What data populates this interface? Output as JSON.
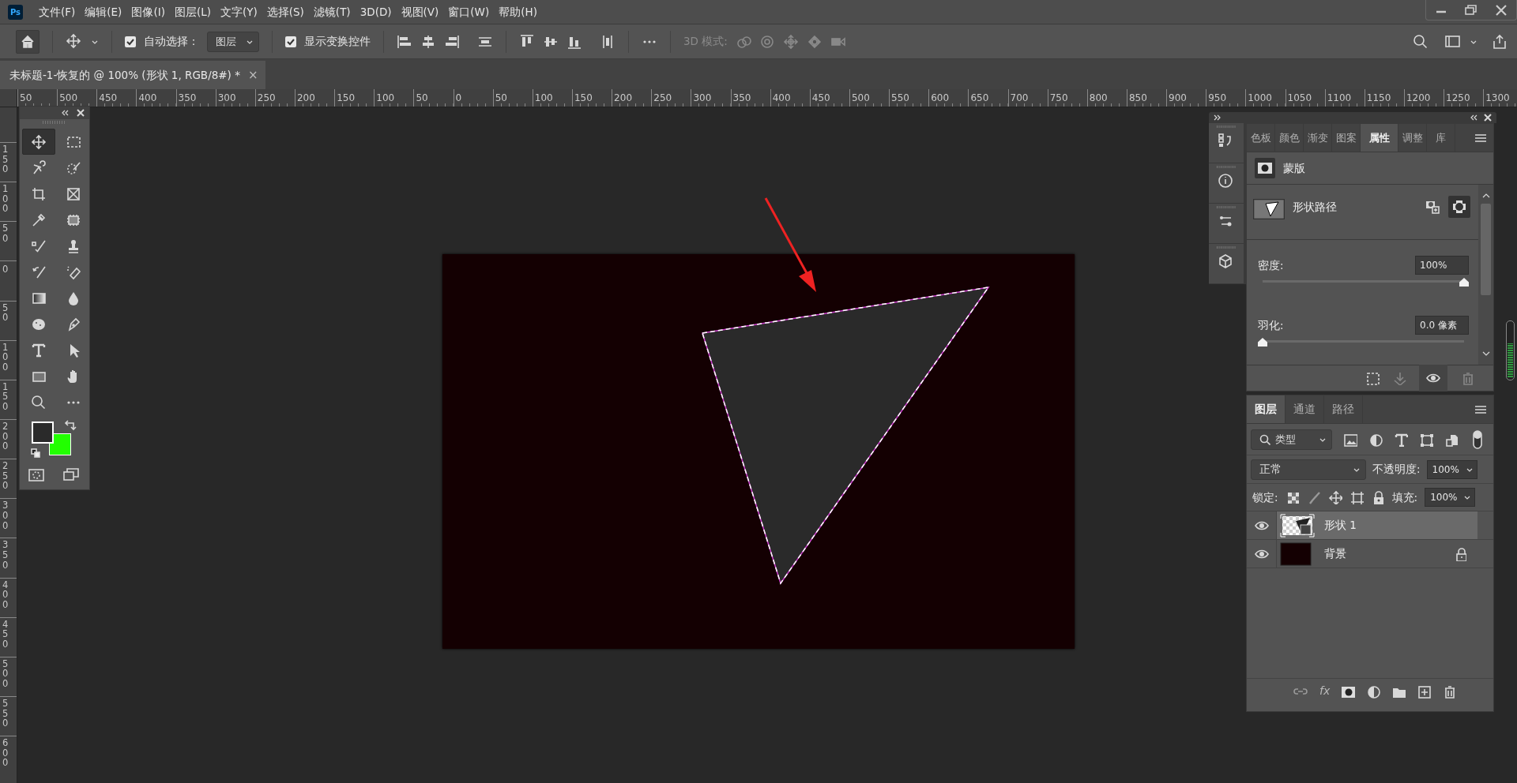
{
  "menu_bar": {
    "app_icon": "Ps",
    "items": [
      "文件(F)",
      "编辑(E)",
      "图像(I)",
      "图层(L)",
      "文字(Y)",
      "选择(S)",
      "滤镜(T)",
      "3D(D)",
      "视图(V)",
      "窗口(W)",
      "帮助(H)"
    ]
  },
  "options_bar": {
    "auto_select": {
      "label": "自动选择：",
      "checked": true
    },
    "auto_select_target": "图层",
    "show_transform": {
      "label": "显示变换控件",
      "checked": true
    },
    "mode_3d_label": "3D 模式:"
  },
  "document_tabs": [
    {
      "title": "未标题-1-恢复的 @ 100% (形状 1, RGB/8#) *",
      "selected": true,
      "close": "×"
    }
  ],
  "rulers": {
    "horizontal": [
      "50",
      "500",
      "450",
      "400",
      "350",
      "300",
      "250",
      "200",
      "150",
      "100",
      "50",
      "0",
      "50",
      "100",
      "150",
      "200",
      "250",
      "300",
      "350",
      "400",
      "450",
      "500",
      "550",
      "600",
      "650",
      "700",
      "750",
      "800",
      "850",
      "900",
      "950",
      "1000",
      "1050",
      "1100",
      "1150",
      "1200",
      "1250",
      "1300"
    ],
    "vertical": [
      "150",
      "100",
      "50",
      "0",
      "50",
      "100",
      "150",
      "200",
      "250",
      "300",
      "350",
      "400",
      "450",
      "500",
      "550",
      "600"
    ]
  },
  "toolbox": {
    "tools": [
      {
        "selected": true
      },
      {
        "selected": false
      },
      {
        "selected": false
      },
      {
        "selected": false
      },
      {
        "selected": false
      },
      {
        "selected": false
      },
      {
        "selected": false
      },
      {
        "selected": false
      },
      {
        "selected": false
      },
      {
        "selected": false
      },
      {
        "selected": false
      },
      {
        "selected": false
      },
      {
        "selected": false
      },
      {
        "selected": false
      },
      {
        "selected": false
      },
      {
        "selected": false
      },
      {
        "selected": false
      },
      {
        "selected": false
      },
      {
        "selected": false
      },
      {
        "selected": false
      },
      {
        "selected": false
      },
      {
        "selected": false
      }
    ],
    "swatches": [
      {
        "kind": "foreground",
        "color": "#2a2a2a"
      },
      {
        "kind": "background",
        "color": "#22ff00"
      }
    ]
  },
  "properties_panel": {
    "tabs": [
      {
        "label": "色板",
        "selected": false
      },
      {
        "label": "颜色",
        "selected": false
      },
      {
        "label": "渐变",
        "selected": false
      },
      {
        "label": "图案",
        "selected": false
      },
      {
        "label": "属性",
        "selected": true
      },
      {
        "label": "调整",
        "selected": false
      },
      {
        "label": "库",
        "selected": false
      }
    ],
    "section_title": "蒙版",
    "path_label": "形状路径",
    "density": {
      "label": "密度:",
      "value": "100%",
      "level": 1.0
    },
    "feather": {
      "label": "羽化:",
      "value": "0.0 像素",
      "level": 0.0
    }
  },
  "layers_panel": {
    "tabs": [
      {
        "label": "图层",
        "selected": true
      },
      {
        "label": "通道",
        "selected": false
      },
      {
        "label": "路径",
        "selected": false
      }
    ],
    "filter": {
      "value": "类型"
    },
    "blend_mode": "正常",
    "opacity": {
      "label": "不透明度:",
      "value": "100%"
    },
    "lock_label": "锁定:",
    "fill": {
      "label": "填充:",
      "value": "100%"
    },
    "layers": [
      {
        "name": "形状 1",
        "kind": "shape",
        "selected": true,
        "visible": true,
        "locked": false
      },
      {
        "name": "背景",
        "kind": "background",
        "selected": false,
        "visible": true,
        "locked": true
      }
    ],
    "footer_fx": "fx"
  }
}
